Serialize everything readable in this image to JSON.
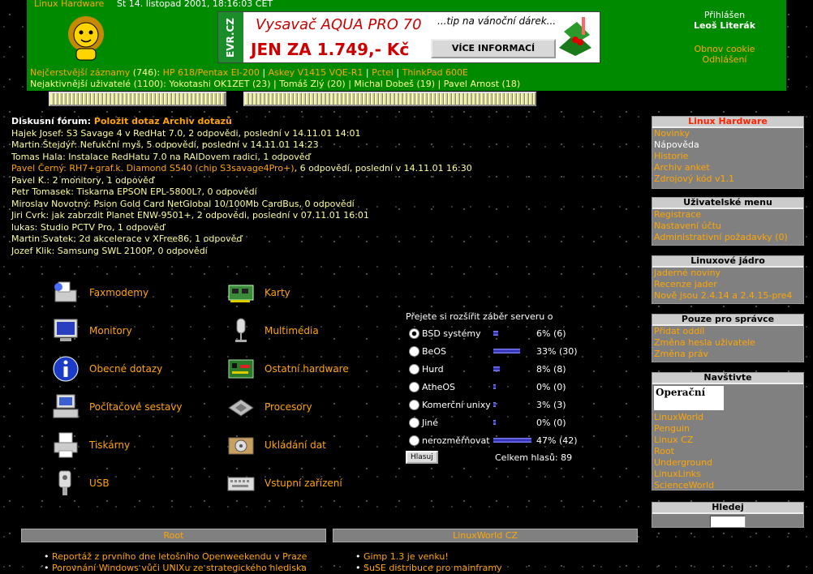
{
  "header": {
    "brand": "Linux Hardware",
    "date": "St 14. listopad 2001, 18:16:03 CET",
    "banner": {
      "side_text": "EVR.CZ",
      "product": "Vysavač AQUA PRO 70",
      "price": "JEN ZA 1.749,- Kč",
      "tip": "...tip na vánoční dárek...",
      "more_button": "VÍCE INFORMACÍ"
    },
    "login": {
      "label": "Přihlášen",
      "user": "Leoš Literák",
      "cookie": "Obnov cookie",
      "logout": "Odhlášení"
    },
    "latest": {
      "label": "Nejčerstvější záznamy",
      "count": "(746):",
      "items": [
        "HP 618/Pentax EI-200",
        "Askey V1415 VQE-R1",
        "Pctel",
        "ThinkPad 600E"
      ]
    },
    "active_users": {
      "label": "Nejaktivnější uživatelé",
      "count": "(1100):",
      "items": [
        "Yokotashi OK1ZET (23)",
        "Tomáš Zlý (20)",
        "Michal Dobeš (19)",
        "Pavel Arnost (18)"
      ]
    }
  },
  "forum": {
    "title": "Diskusní fórum:",
    "ask_link": "Položit dotaz",
    "archive_link": "Archiv dotazů",
    "rows": [
      {
        "a": "Hajek Josef:",
        "t": "S3 Savage 4 v RedHat 7.0",
        "r": ", 2 odpovědi, poslední v 14.11.01 14:01",
        "hl": false
      },
      {
        "a": "Martin Štejdýř:",
        "t": "Nefukční myš",
        "r": ", 5 odpovědí, poslední v 14.11.01 14:23",
        "hl": false
      },
      {
        "a": "Tomas Hala:",
        "t": "Instalace RedHatu 7.0 na RAIDovem radici",
        "r": ", 1 odpověď",
        "hl": false
      },
      {
        "a": "Pavel Černý:",
        "t": "RH7+graf.k. Diamond S540 (chip S3savage4Pro+)",
        "r": ", 6 odpovědí, poslední v 14.11.01 16:30",
        "hl": true
      },
      {
        "a": "Pavel K.:",
        "t": "2 monitory",
        "r": ", 1 odpověď",
        "hl": false
      },
      {
        "a": "Petr Tomasek:",
        "t": "Tiskarna EPSON EPL-5800L?",
        "r": ", 0 odpovědí",
        "hl": false
      },
      {
        "a": "Miroslav Novotný:",
        "t": "Psion Gold Card NetGlobal 10/100Mb CardBus",
        "r": ", 0 odpovědí",
        "hl": false
      },
      {
        "a": "Jiri Cvrk:",
        "t": "jak zabrzdit Planet ENW-9501+",
        "r": ", 2 odpovědi, poslední v 07.11.01 16:01",
        "hl": false
      },
      {
        "a": "lukas:",
        "t": "Studio PCTV Pro",
        "r": ", 1 odpověď",
        "hl": false
      },
      {
        "a": "Martin Svatek:",
        "t": "2d akcelerace v XFree86",
        "r": ", 1 odpověď",
        "hl": false
      },
      {
        "a": "Jozef Klik:",
        "t": "Samsung SWL 2100P",
        "r": ", 0 odpovědí",
        "hl": false
      }
    ]
  },
  "categories": {
    "faxmodemy": "Faxmodemy",
    "karty": "Karty",
    "monitory": "Monitory",
    "multimedia": "Multimédia",
    "obecne": "Obecné dotazy",
    "ostatni": "Ostatní hardware",
    "sestavy": "Počítačové sestavy",
    "procesory": "Procesory",
    "tiskarny": "Tiskárny",
    "ukladani": "Ukládání dat",
    "usb": "USB",
    "vstupni": "Vstupní zařízení"
  },
  "poll": {
    "question": "Přejete si rozšířit záběr serveru o",
    "options": [
      {
        "label": "BSD systémy",
        "percent": 6,
        "pct_text": "6% (6)"
      },
      {
        "label": "BeOS",
        "percent": 33,
        "pct_text": "33% (30)"
      },
      {
        "label": "Hurd",
        "percent": 8,
        "pct_text": "8% (8)"
      },
      {
        "label": "AtheOS",
        "percent": 0,
        "pct_text": "0% (0)"
      },
      {
        "label": "Komerční unixy",
        "percent": 3,
        "pct_text": "3% (3)"
      },
      {
        "label": "Jiné",
        "percent": 0,
        "pct_text": "0% (0)"
      },
      {
        "label": "nerozměřňovat",
        "percent": 47,
        "pct_text": "47% (42)"
      }
    ],
    "vote_button": "Hlasuj",
    "total": "Celkem hlasů: 89"
  },
  "sidebar": {
    "lh": {
      "title": "Linux Hardware",
      "items": [
        "Novinky",
        "Nápověda",
        "Historie",
        "Archiv anket",
        "Zdrojový kód v1.1"
      ]
    },
    "user": {
      "title": "Uživatelské menu",
      "items": [
        "Registrace",
        "Nastavení účtu",
        "Administrativní požadavky (0)"
      ]
    },
    "kernel": {
      "title": "Linuxové jádro",
      "items": [
        "Jaderné noviny",
        "Recenze jader",
        "Nově jsou 2.4.14 a 2.4.15-pre4"
      ]
    },
    "admin": {
      "title": "Pouze pro správce",
      "items": [
        "Přidat oddíl",
        "Změna hesla uživatele",
        "Změna práv"
      ]
    },
    "visit": {
      "title": "Navštivte",
      "logo": "Operační",
      "items": [
        "LinuxWorld",
        "Penguin",
        "Linux CZ",
        "Root",
        "Underground",
        "LinuxLinks",
        "ScienceWorld"
      ]
    },
    "search": {
      "title": "Hledej"
    }
  },
  "bottom": {
    "root": {
      "title": "Root",
      "items": [
        "Reportáž z prvního dne letošního Openweekendu v Praze",
        "Porovnání Windows vůči UNIXu ze strategického hlediska"
      ]
    },
    "linuxworld": {
      "title": "LinuxWorld CZ",
      "items": [
        "Gimp 1.3 je venku!",
        "SuSE distribuce pro mainframy"
      ]
    }
  }
}
